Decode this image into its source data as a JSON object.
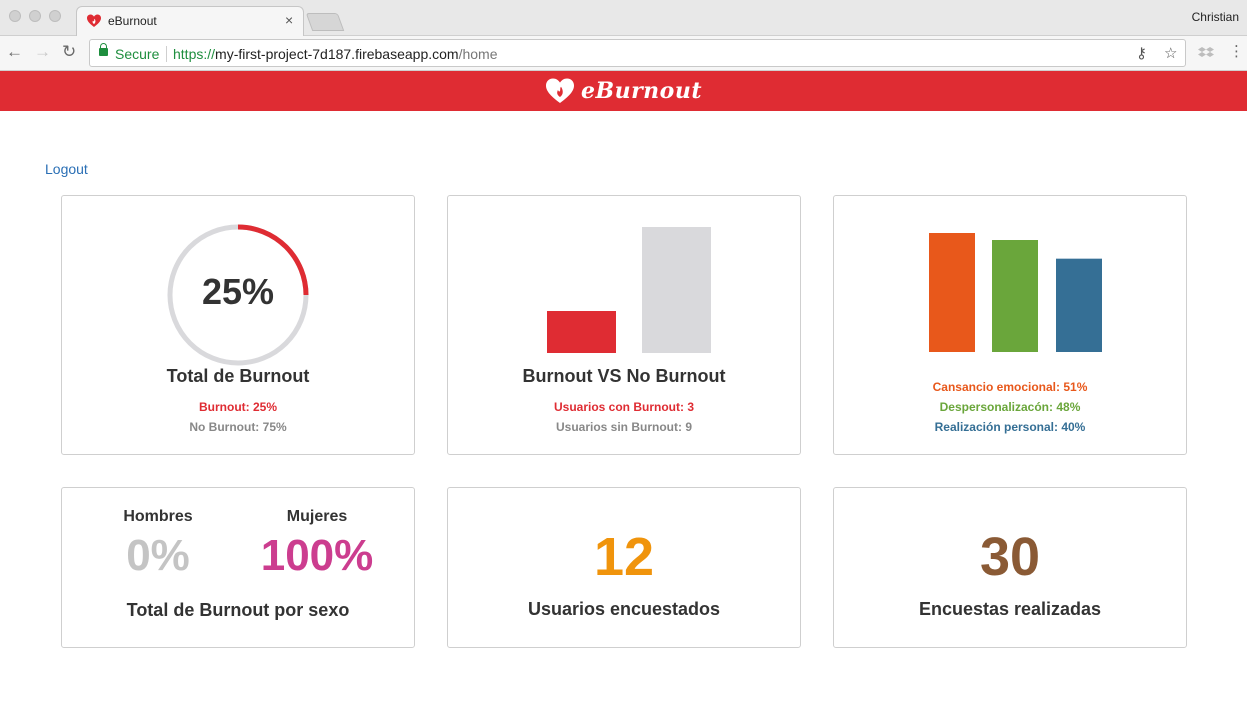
{
  "browser": {
    "tab_title": "eBurnout",
    "tab_close": "×",
    "profile_name": "Christian",
    "secure_label": "Secure",
    "url_scheme": "https://",
    "url_host": "my-first-project-7d187.firebaseapp.com",
    "url_path": "/home",
    "back_icon": "←",
    "forward_icon": "→",
    "reload_icon": "↻",
    "key_icon": "⚷",
    "star_icon": "☆",
    "menu_icon": "⋮"
  },
  "app": {
    "brand": "eBurnout",
    "logout": "Logout",
    "colors": {
      "brand_red": "#df2c33",
      "gray": "#d9d9dc",
      "orange": "#e8581b",
      "green": "#6aa63b",
      "blue": "#356f95",
      "pink": "#cc3d8f",
      "amber": "#f0940c",
      "brown": "#8a5a35"
    }
  },
  "cards": {
    "total": {
      "percent_text": "25%",
      "title": "Total de Burnout",
      "line1": "Burnout: 25%",
      "line2": "No Burnout: 75%"
    },
    "vs": {
      "title": "Burnout VS No Burnout",
      "line1": "Usuarios con Burnout: 3",
      "line2": "Usuarios sin Burnout: 9"
    },
    "dimensions": {
      "line1": "Cansancio emocional: 51%",
      "line2": "Despersonalizacón: 48%",
      "line3": "Realización personal: 40%"
    },
    "sex": {
      "men_label": "Hombres",
      "men_value": "0%",
      "women_label": "Mujeres",
      "women_value": "100%",
      "title": "Total de Burnout por sexo"
    },
    "users": {
      "value": "12",
      "title": "Usuarios encuestados"
    },
    "surveys": {
      "value": "30",
      "title": "Encuestas realizadas"
    }
  },
  "chart_data": [
    {
      "type": "pie",
      "categories": [
        "Burnout",
        "No Burnout"
      ],
      "values": [
        25,
        75
      ]
    },
    {
      "type": "bar",
      "categories": [
        "Usuarios con Burnout",
        "Usuarios sin Burnout"
      ],
      "values": [
        3,
        9
      ]
    },
    {
      "type": "bar",
      "categories": [
        "Cansancio emocional",
        "Despersonalizacón",
        "Realización personal"
      ],
      "values": [
        51,
        48,
        40
      ]
    }
  ]
}
